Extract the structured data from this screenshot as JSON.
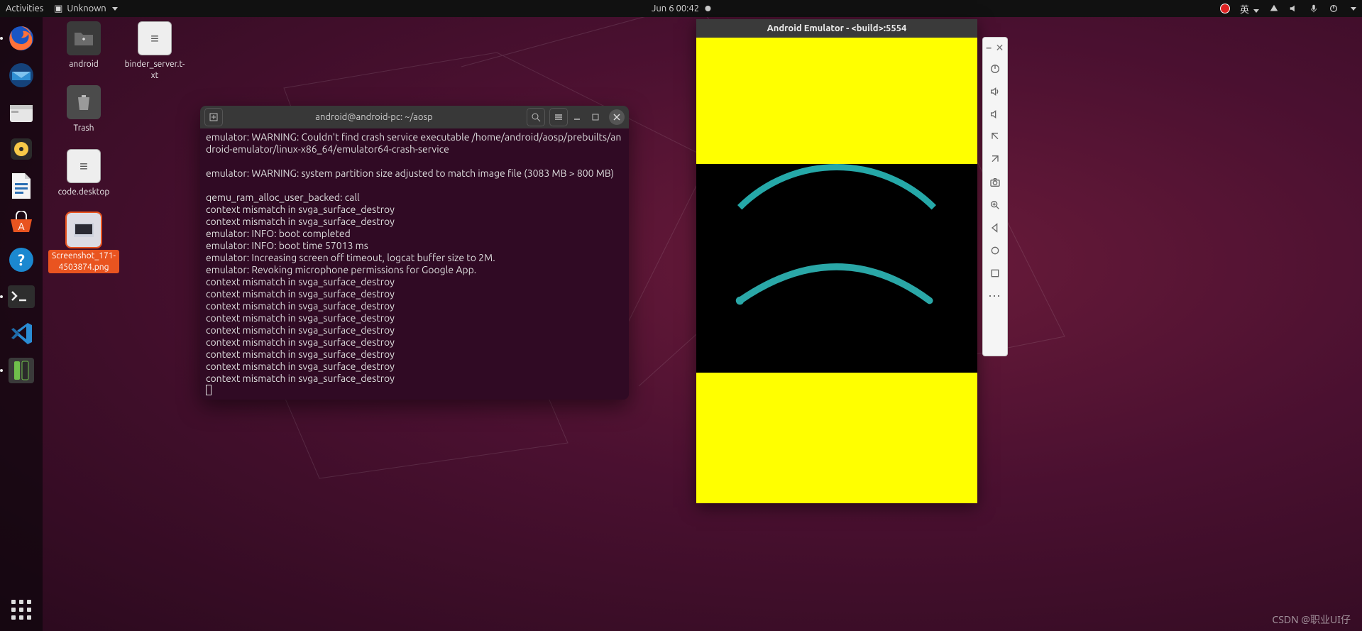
{
  "topbar": {
    "activities": "Activities",
    "appname": "Unknown",
    "datetime": "Jun 6  00:42",
    "ime": "英"
  },
  "dock": {
    "items": [
      {
        "name": "firefox"
      },
      {
        "name": "thunderbird"
      },
      {
        "name": "files"
      },
      {
        "name": "rhythmbox"
      },
      {
        "name": "writer"
      },
      {
        "name": "software"
      },
      {
        "name": "help"
      },
      {
        "name": "terminal"
      },
      {
        "name": "vscode"
      },
      {
        "name": "emulator"
      }
    ]
  },
  "desktop_icons": {
    "android": "android",
    "binder": "binder_server.t-xt",
    "trash": "Trash",
    "code": "code.desktop",
    "screenshot": "Screenshot_171-4503874.png"
  },
  "terminal": {
    "title": "android@android-pc: ~/aosp",
    "lines": [
      "emulator: WARNING: Couldn't find crash service executable /home/android/aosp/prebuilts/android-emulator/linux-x86_64/emulator64-crash-service",
      "",
      "emulator: WARNING: system partition size adjusted to match image file (3083 MB > 800 MB)",
      "",
      "qemu_ram_alloc_user_backed: call",
      "context mismatch in svga_surface_destroy",
      "context mismatch in svga_surface_destroy",
      "emulator: INFO: boot completed",
      "emulator: INFO: boot time 57013 ms",
      "emulator: Increasing screen off timeout, logcat buffer size to 2M.",
      "emulator: Revoking microphone permissions for Google App.",
      "context mismatch in svga_surface_destroy",
      "context mismatch in svga_surface_destroy",
      "context mismatch in svga_surface_destroy",
      "context mismatch in svga_surface_destroy",
      "context mismatch in svga_surface_destroy",
      "context mismatch in svga_surface_destroy",
      "context mismatch in svga_surface_destroy",
      "context mismatch in svga_surface_destroy",
      "context mismatch in svga_surface_destroy"
    ]
  },
  "emulator": {
    "title": "Android Emulator - <build>:5554"
  },
  "watermark": "CSDN @职业UI仔"
}
